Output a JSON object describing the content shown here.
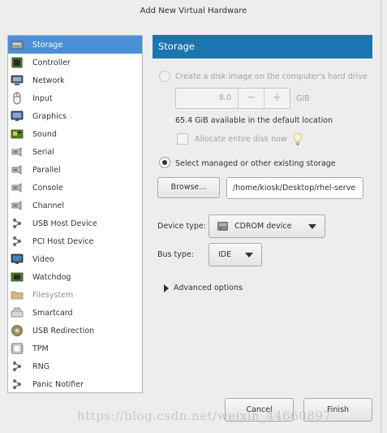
{
  "window": {
    "title": "Add New Virtual Hardware"
  },
  "sidebar": {
    "items": [
      {
        "label": "Storage",
        "icon": "hard-disk-icon",
        "selected": true,
        "disabled": false
      },
      {
        "label": "Controller",
        "icon": "controller-chip-icon",
        "selected": false,
        "disabled": false
      },
      {
        "label": "Network",
        "icon": "network-icon",
        "selected": false,
        "disabled": false
      },
      {
        "label": "Input",
        "icon": "mouse-icon",
        "selected": false,
        "disabled": false
      },
      {
        "label": "Graphics",
        "icon": "monitor-icon",
        "selected": false,
        "disabled": false
      },
      {
        "label": "Sound",
        "icon": "sound-card-icon",
        "selected": false,
        "disabled": false
      },
      {
        "label": "Serial",
        "icon": "serial-port-icon",
        "selected": false,
        "disabled": false
      },
      {
        "label": "Parallel",
        "icon": "parallel-port-icon",
        "selected": false,
        "disabled": false
      },
      {
        "label": "Console",
        "icon": "console-port-icon",
        "selected": false,
        "disabled": false
      },
      {
        "label": "Channel",
        "icon": "channel-port-icon",
        "selected": false,
        "disabled": false
      },
      {
        "label": "USB Host Device",
        "icon": "usb-device-icon",
        "selected": false,
        "disabled": false
      },
      {
        "label": "PCI Host Device",
        "icon": "pci-device-icon",
        "selected": false,
        "disabled": false
      },
      {
        "label": "Video",
        "icon": "video-monitor-icon",
        "selected": false,
        "disabled": false
      },
      {
        "label": "Watchdog",
        "icon": "watchdog-chip-icon",
        "selected": false,
        "disabled": false
      },
      {
        "label": "Filesystem",
        "icon": "folder-icon",
        "selected": false,
        "disabled": true
      },
      {
        "label": "Smartcard",
        "icon": "smartcard-icon",
        "selected": false,
        "disabled": false
      },
      {
        "label": "USB Redirection",
        "icon": "usb-redirection-icon",
        "selected": false,
        "disabled": false
      },
      {
        "label": "TPM",
        "icon": "tpm-chip-icon",
        "selected": false,
        "disabled": false
      },
      {
        "label": "RNG",
        "icon": "rng-icon",
        "selected": false,
        "disabled": false
      },
      {
        "label": "Panic Notifier",
        "icon": "panic-notifier-icon",
        "selected": false,
        "disabled": false
      }
    ]
  },
  "storage": {
    "header": "Storage",
    "create_option": {
      "label": "Create a disk image on the computer's hard drive",
      "selected": false,
      "disabled": true
    },
    "size": {
      "value": "8.0",
      "minus": "−",
      "plus": "+",
      "unit": "GiB"
    },
    "available_text": "65.4 GiB available in the default location",
    "allocate": {
      "label": "Allocate entire disk now",
      "checked": false,
      "icon": "lightbulb-hint-icon"
    },
    "existing_option": {
      "label": "Select managed or other existing storage",
      "selected": true
    },
    "browse_label": "Browse...",
    "path_value": "/home/kiosk/Desktop/rhel-serve",
    "device_type": {
      "label": "Device type:",
      "value": "CDROM device",
      "icon": "cdrom-icon"
    },
    "bus_type": {
      "label": "Bus type:",
      "value": "IDE"
    },
    "advanced_label": "Advanced options"
  },
  "buttons": {
    "cancel": "Cancel",
    "finish": "Finish"
  },
  "watermark": "https://blog.csdn.net/weixin_44660897",
  "colors": {
    "selection": "#4a90d9",
    "header": "#1b75b0",
    "window_bg": "#ededed"
  }
}
